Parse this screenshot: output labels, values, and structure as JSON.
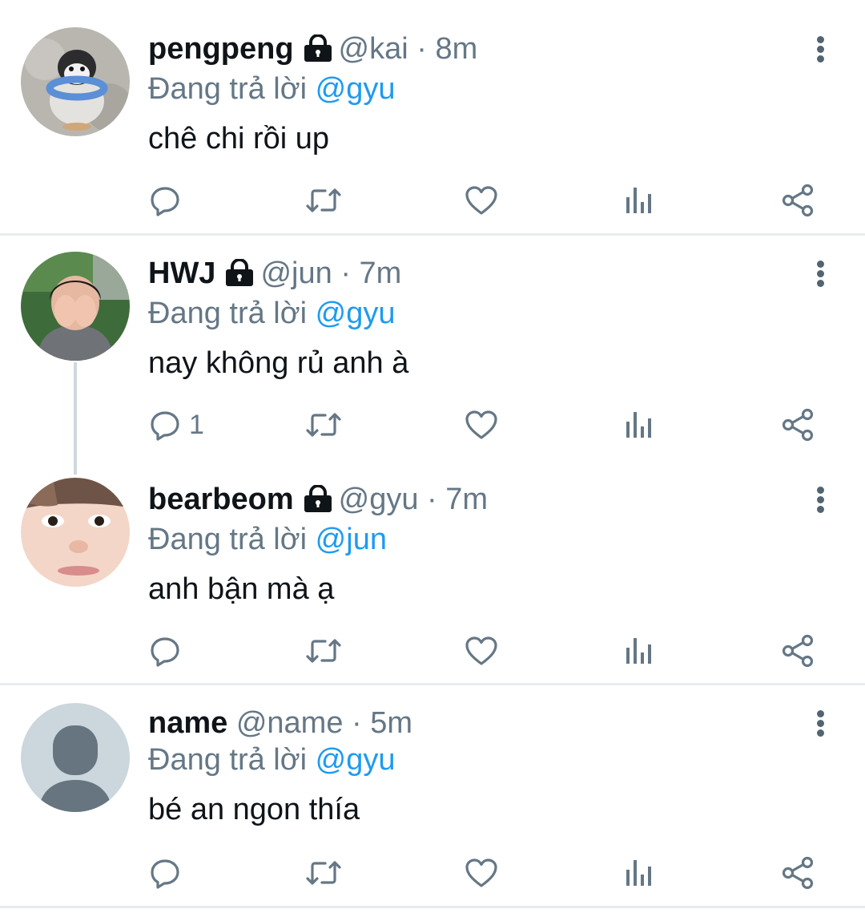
{
  "tweets": [
    {
      "name": "pengpeng",
      "protected": true,
      "handle": "@kai",
      "separator": "·",
      "time": "8m",
      "reply_prefix": "Đang trả lời",
      "reply_to": "@gyu",
      "text": "chê chi rồi up",
      "reply_count": "",
      "avatar": "penguin-avatar"
    },
    {
      "name": "HWJ",
      "protected": true,
      "handle": "@jun",
      "separator": "·",
      "time": "7m",
      "reply_prefix": "Đang trả lời",
      "reply_to": "@gyu",
      "text": "nay không rủ anh à",
      "reply_count": "1",
      "avatar": "person-covering-face-avatar"
    },
    {
      "name": "bearbeom",
      "protected": true,
      "handle": "@gyu",
      "separator": "·",
      "time": "7m",
      "reply_prefix": "Đang trả lời",
      "reply_to": "@jun",
      "text": "anh bận mà ạ",
      "reply_count": "",
      "avatar": "closeup-face-avatar"
    },
    {
      "name": "name",
      "protected": false,
      "handle": "@name",
      "separator": "·",
      "time": "5m",
      "reply_prefix": "Đang trả lời",
      "reply_to": "@gyu",
      "text": "bé an ngon thía",
      "reply_count": "",
      "avatar": "default-avatar"
    }
  ],
  "icons": {
    "reply": "reply-icon",
    "retweet": "retweet-icon",
    "like": "heart-icon",
    "analytics": "analytics-icon",
    "share": "share-icon",
    "more": "more-vertical-icon",
    "lock": "lock-icon"
  },
  "colors": {
    "text": "#0f1419",
    "secondary": "#657786",
    "mention": "#1d9bf0",
    "divider": "#e6ecf0"
  }
}
